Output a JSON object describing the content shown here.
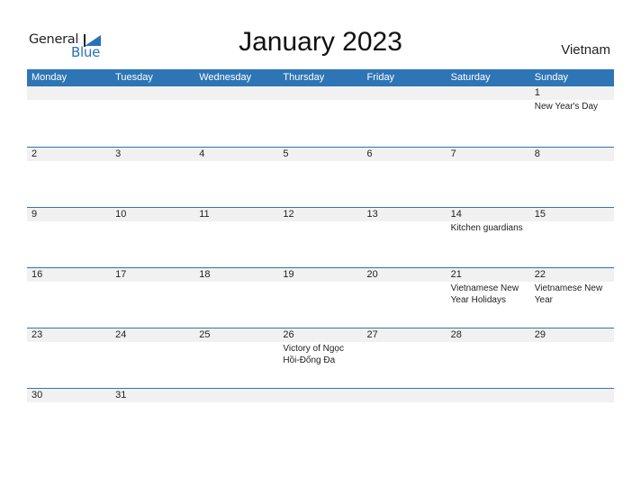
{
  "logo": {
    "word1": "General",
    "word2": "Blue",
    "icon": "blue-triangle-logo-icon"
  },
  "title": "January 2023",
  "country": "Vietnam",
  "colors": {
    "header_bg": "#2e75b6",
    "band_bg": "#f1f1f1",
    "logo_blue": "#2a72b8"
  },
  "weekdays": [
    "Monday",
    "Tuesday",
    "Wednesday",
    "Thursday",
    "Friday",
    "Saturday",
    "Sunday"
  ],
  "weeks": [
    [
      {
        "day": "",
        "event": ""
      },
      {
        "day": "",
        "event": ""
      },
      {
        "day": "",
        "event": ""
      },
      {
        "day": "",
        "event": ""
      },
      {
        "day": "",
        "event": ""
      },
      {
        "day": "",
        "event": ""
      },
      {
        "day": "1",
        "event": "New Year's Day"
      }
    ],
    [
      {
        "day": "2",
        "event": ""
      },
      {
        "day": "3",
        "event": ""
      },
      {
        "day": "4",
        "event": ""
      },
      {
        "day": "5",
        "event": ""
      },
      {
        "day": "6",
        "event": ""
      },
      {
        "day": "7",
        "event": ""
      },
      {
        "day": "8",
        "event": ""
      }
    ],
    [
      {
        "day": "9",
        "event": ""
      },
      {
        "day": "10",
        "event": ""
      },
      {
        "day": "11",
        "event": ""
      },
      {
        "day": "12",
        "event": ""
      },
      {
        "day": "13",
        "event": ""
      },
      {
        "day": "14",
        "event": "Kitchen guardians"
      },
      {
        "day": "15",
        "event": ""
      }
    ],
    [
      {
        "day": "16",
        "event": ""
      },
      {
        "day": "17",
        "event": ""
      },
      {
        "day": "18",
        "event": ""
      },
      {
        "day": "19",
        "event": ""
      },
      {
        "day": "20",
        "event": ""
      },
      {
        "day": "21",
        "event": "Vietnamese New Year Holidays"
      },
      {
        "day": "22",
        "event": "Vietnamese New Year"
      }
    ],
    [
      {
        "day": "23",
        "event": ""
      },
      {
        "day": "24",
        "event": ""
      },
      {
        "day": "25",
        "event": ""
      },
      {
        "day": "26",
        "event": "Victory of Ngọc Hồi-Đống Đa"
      },
      {
        "day": "27",
        "event": ""
      },
      {
        "day": "28",
        "event": ""
      },
      {
        "day": "29",
        "event": ""
      }
    ],
    [
      {
        "day": "30",
        "event": ""
      },
      {
        "day": "31",
        "event": ""
      },
      {
        "day": "",
        "event": ""
      },
      {
        "day": "",
        "event": ""
      },
      {
        "day": "",
        "event": ""
      },
      {
        "day": "",
        "event": ""
      },
      {
        "day": "",
        "event": ""
      }
    ]
  ]
}
